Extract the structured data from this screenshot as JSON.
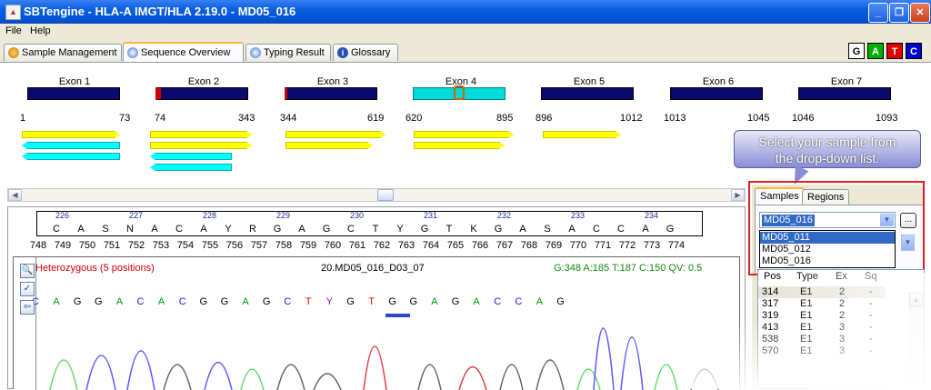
{
  "window": {
    "title": "SBTengine - HLA-A IMGT/HLA 2.19.0 - MD05_016",
    "min": "_",
    "max": "❐",
    "close": "✕"
  },
  "menu": [
    "File",
    "Help"
  ],
  "tabs": [
    "Sample Management",
    "Sequence Overview",
    "Typing Result",
    "Glossary"
  ],
  "gatc": [
    "G",
    "A",
    "T",
    "C"
  ],
  "gatc_colors": {
    "G": "#000000",
    "A": "#00b000",
    "T": "#e00000",
    "C": "#0000cc"
  },
  "exons": [
    {
      "label": "Exon 1",
      "start": "1",
      "end": "73"
    },
    {
      "label": "Exon 2",
      "start": "74",
      "end": "343"
    },
    {
      "label": "Exon 3",
      "start": "344",
      "end": "619"
    },
    {
      "label": "Exon 4",
      "start": "620",
      "end": "895"
    },
    {
      "label": "Exon 5",
      "start": "896",
      "end": "1012"
    },
    {
      "label": "Exon 6",
      "start": "1013",
      "end": "1045"
    },
    {
      "label": "Exon 7",
      "start": "1046",
      "end": "1093"
    }
  ],
  "callout": {
    "line1": "Select your sample from",
    "line2": "the drop-down list."
  },
  "codons": [
    "226",
    "227",
    "228",
    "229",
    "230",
    "231",
    "232",
    "233",
    "234"
  ],
  "amino_acids": [
    "C",
    "A",
    "S",
    "N",
    "A",
    "C",
    "A",
    "Y",
    "R",
    "G",
    "A",
    "G",
    "C",
    "T",
    "Y",
    "G",
    "T",
    "K",
    "G",
    "A",
    "S",
    "A",
    "C",
    "C",
    "A",
    "G"
  ],
  "positions": [
    "748",
    "749",
    "750",
    "751",
    "752",
    "753",
    "754",
    "755",
    "756",
    "757",
    "758",
    "759",
    "760",
    "761",
    "762",
    "763",
    "764",
    "765",
    "766",
    "767",
    "768",
    "769",
    "770",
    "771",
    "772",
    "773",
    "774"
  ],
  "trace": {
    "status": "Heterozygous (5 positions)",
    "name": "20.MD05_016_D03_07",
    "stats": "G:348 A:185 T:187 C:150 QV: 0.5",
    "bases": [
      "C",
      "A",
      "G",
      "G",
      "A",
      "C",
      "A",
      "C",
      "G",
      "G",
      "A",
      "G",
      "C",
      "T",
      "Y",
      "G",
      "T",
      "G",
      "G",
      "A",
      "G",
      "A",
      "C",
      "C",
      "A",
      "G"
    ]
  },
  "right_panel": {
    "tabs": [
      "Samples",
      "Regions"
    ],
    "selected_sample": "MD05_016",
    "browse": "...",
    "options": [
      "MD05_011",
      "MD05_012",
      "MD05_016"
    ],
    "table": {
      "headers": [
        "Pos",
        "Type",
        "Ex",
        "Sq"
      ],
      "rows": [
        [
          "314",
          "E1",
          "2",
          "-"
        ],
        [
          "317",
          "E1",
          "2",
          "-"
        ],
        [
          "319",
          "E1",
          "2",
          "-"
        ],
        [
          "413",
          "E1",
          "3",
          "-"
        ],
        [
          "538",
          "E1",
          "3",
          "-"
        ],
        [
          "570",
          "E1",
          "3",
          "-"
        ]
      ]
    }
  }
}
